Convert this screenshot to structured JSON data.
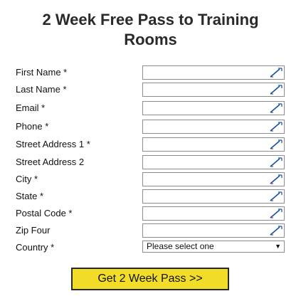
{
  "form": {
    "title": "2 Week Free Pass to Training Rooms",
    "fields": [
      {
        "label": "First Name *",
        "value": "",
        "icon": "pen-autofill-icon"
      },
      {
        "label": "Last Name *",
        "value": "",
        "icon": "pen-autofill-icon"
      },
      {
        "label": "Email *",
        "value": "",
        "icon": "pen-autofill-icon"
      },
      {
        "label": "Phone *",
        "value": "",
        "icon": "pen-autofill-icon"
      },
      {
        "label": "Street Address 1 *",
        "value": "",
        "icon": "pen-autofill-icon"
      },
      {
        "label": "Street Address 2",
        "value": "",
        "icon": "pen-autofill-icon"
      },
      {
        "label": "City *",
        "value": "",
        "icon": "pen-autofill-icon"
      },
      {
        "label": "State *",
        "value": "",
        "icon": "pen-autofill-icon"
      },
      {
        "label": "Postal Code *",
        "value": "",
        "icon": "pen-autofill-icon"
      },
      {
        "label": "Zip Four",
        "value": "",
        "icon": "pen-autofill-icon"
      }
    ],
    "country": {
      "label": "Country *",
      "selected": "Please select one",
      "icon": "dropdown-arrow-icon"
    },
    "submit_label": "Get 2 Week Pass >>",
    "colors": {
      "button_bg": "#f3dd2b",
      "border": "#8c8c8c",
      "title": "#2a2a2a"
    }
  }
}
